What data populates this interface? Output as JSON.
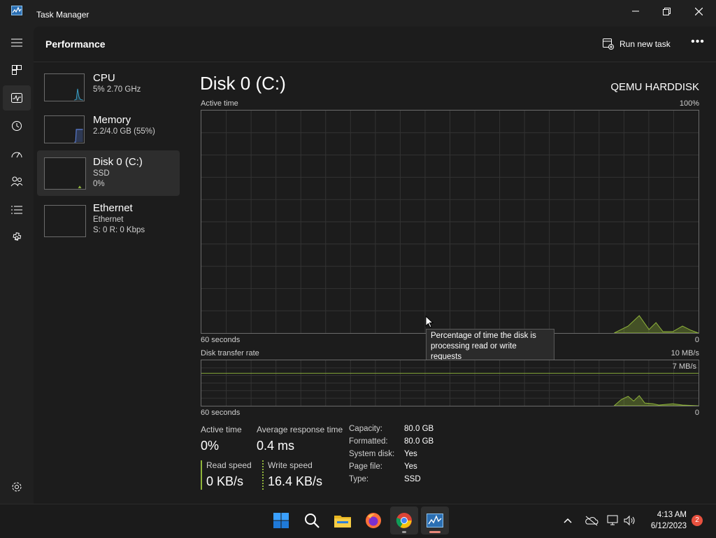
{
  "window": {
    "title": "Task Manager"
  },
  "header": {
    "page_title": "Performance",
    "run_new_task_label": "Run new task",
    "more_label": "•••"
  },
  "rail": {
    "items": [
      {
        "name": "hamburger-menu-icon"
      },
      {
        "name": "processes-icon"
      },
      {
        "name": "performance-icon"
      },
      {
        "name": "app-history-icon"
      },
      {
        "name": "startup-apps-icon"
      },
      {
        "name": "users-icon"
      },
      {
        "name": "details-icon"
      },
      {
        "name": "services-icon"
      }
    ],
    "settings": {
      "name": "settings-icon"
    }
  },
  "resources": [
    {
      "name": "CPU",
      "line1": "5% 2.70 GHz",
      "line2": ""
    },
    {
      "name": "Memory",
      "line1": "2.2/4.0 GB (55%)",
      "line2": ""
    },
    {
      "name": "Disk 0 (C:)",
      "line1": "SSD",
      "line2": "0%"
    },
    {
      "name": "Ethernet",
      "line1": "Ethernet",
      "line2": "S: 0 R: 0 Kbps"
    }
  ],
  "detail": {
    "title": "Disk 0 (C:)",
    "model": "QEMU HARDDISK",
    "active_time_label": "Active time",
    "active_time_max": "100%",
    "active_time_left": "60 seconds",
    "active_time_right": "0",
    "transfer_label": "Disk transfer rate",
    "transfer_max": "10 MB/s",
    "transfer_mark": "7 MB/s",
    "transfer_left": "60 seconds",
    "transfer_right": "0",
    "tooltip": "Percentage of time the disk is processing read or write requests"
  },
  "stats": {
    "active_time": {
      "label": "Active time",
      "value": "0%"
    },
    "avg_response": {
      "label": "Average response time",
      "value": "0.4 ms"
    },
    "read_speed": {
      "label": "Read speed",
      "value": "0 KB/s"
    },
    "write_speed": {
      "label": "Write speed",
      "value": "16.4 KB/s"
    },
    "props": [
      {
        "key": "Capacity:",
        "value": "80.0 GB"
      },
      {
        "key": "Formatted:",
        "value": "80.0 GB"
      },
      {
        "key": "System disk:",
        "value": "Yes"
      },
      {
        "key": "Page file:",
        "value": "Yes"
      },
      {
        "key": "Type:",
        "value": "SSD"
      }
    ]
  },
  "taskbar": {
    "apps": [
      "start-icon",
      "search-icon",
      "file-explorer-icon",
      "firefox-icon",
      "chrome-icon",
      "task-manager-icon"
    ],
    "time": "4:13 AM",
    "date": "6/12/2023",
    "notifications": "2"
  },
  "colors": {
    "accent": "#e8887a",
    "disk_graph": "#8fb43a",
    "cpu_graph": "#3aa0c8",
    "memory_graph": "#5b7fd6"
  }
}
